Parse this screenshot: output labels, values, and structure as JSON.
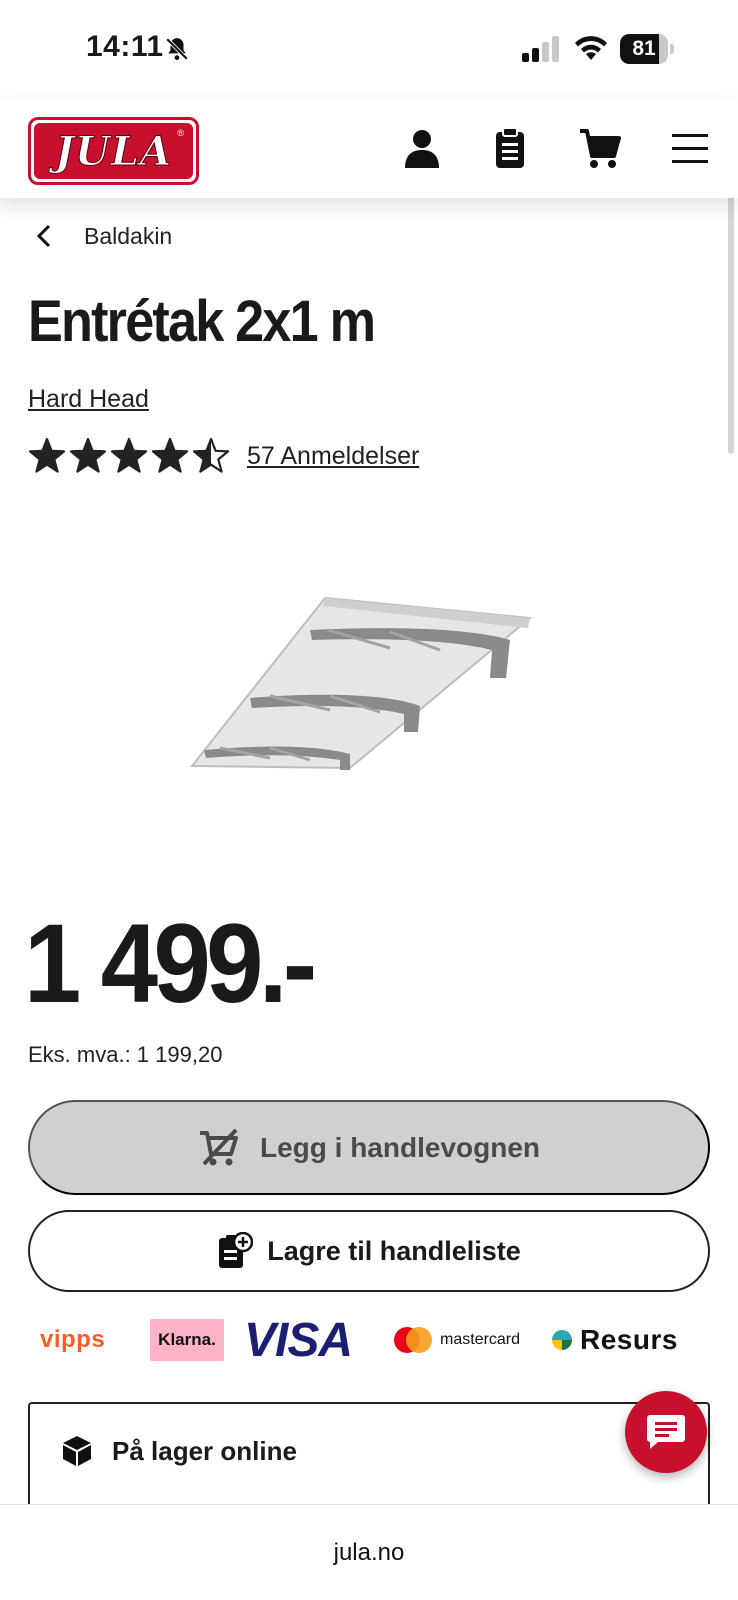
{
  "status_bar": {
    "time": "14:11",
    "battery_level": "81"
  },
  "header": {
    "logo_text": "JULA",
    "icons": [
      "user-icon",
      "clipboard-icon",
      "cart-icon",
      "menu-icon"
    ]
  },
  "breadcrumb": {
    "label": "Baldakin"
  },
  "product": {
    "title": "Entrétak 2x1 m",
    "brand": "Hard Head",
    "rating": 4.5,
    "reviews_label": "57 Anmeldelser",
    "price": "1 499.-",
    "vat_text": "Eks. mva.: 1 199,20"
  },
  "actions": {
    "add_to_cart": "Legg i handlevognen",
    "save_to_list": "Lagre til handleliste"
  },
  "payments": {
    "vipps": "vipps",
    "klarna": "Klarna.",
    "visa": "VISA",
    "mastercard": "mastercard",
    "resurs": "Resurs"
  },
  "stock": {
    "label": "På lager online"
  },
  "browser": {
    "url": "jula.no"
  },
  "colors": {
    "brand_red": "#c8102e",
    "disabled_button": "#d0d0d0"
  }
}
